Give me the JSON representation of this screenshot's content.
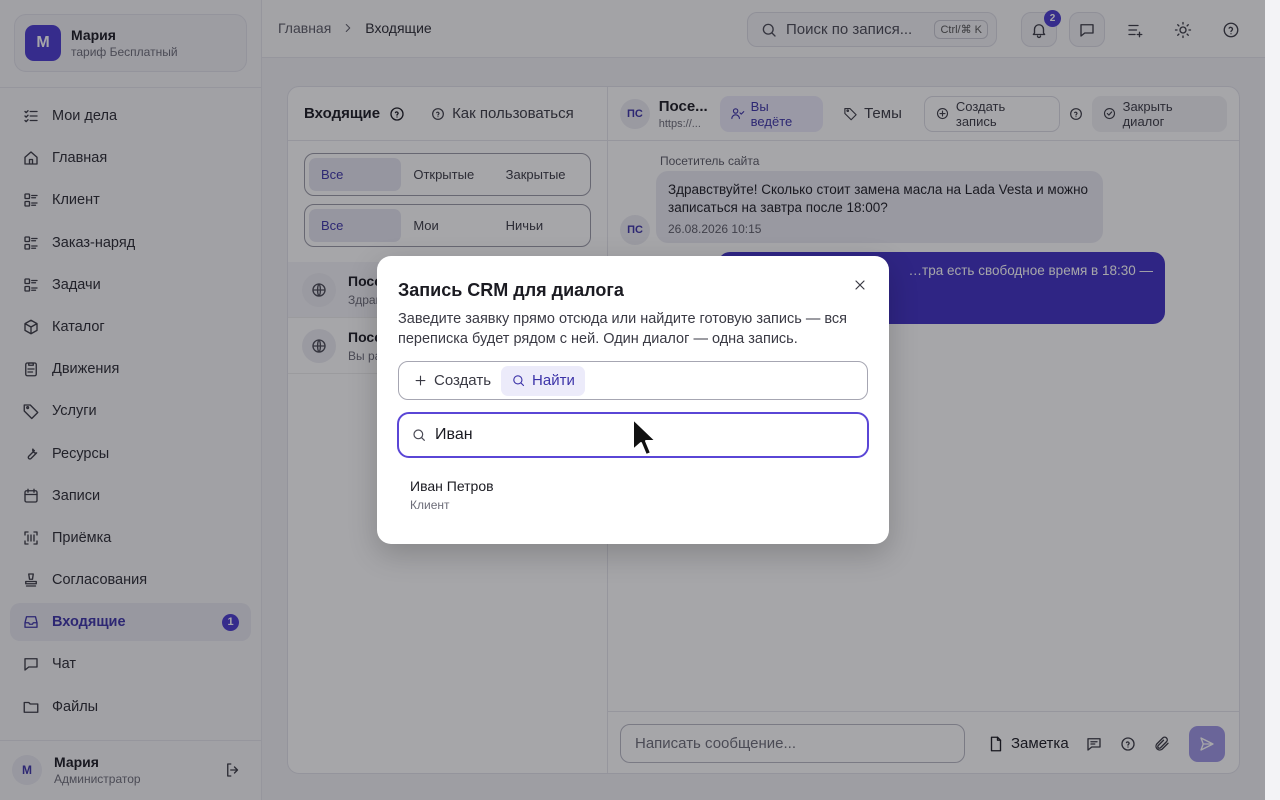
{
  "org": {
    "avatar": "М",
    "name": "Мария",
    "plan": "тариф Бесплатный"
  },
  "nav": [
    {
      "label": "Мои дела",
      "icon": "checklist-icon"
    },
    {
      "label": "Главная",
      "icon": "home-icon"
    },
    {
      "label": "Клиент",
      "icon": "list-icon"
    },
    {
      "label": "Заказ-наряд",
      "icon": "list-icon"
    },
    {
      "label": "Задачи",
      "icon": "list-icon"
    },
    {
      "label": "Каталог",
      "icon": "box-icon"
    },
    {
      "label": "Движения",
      "icon": "clipboard-icon"
    },
    {
      "label": "Услуги",
      "icon": "tag-icon"
    },
    {
      "label": "Ресурсы",
      "icon": "wrench-icon"
    },
    {
      "label": "Записи",
      "icon": "calendar-icon"
    },
    {
      "label": "Приёмка",
      "icon": "scan-icon"
    },
    {
      "label": "Согласования",
      "icon": "stamp-icon"
    },
    {
      "label": "Входящие",
      "icon": "inbox-icon",
      "active": true,
      "badge": "1"
    },
    {
      "label": "Чат",
      "icon": "chat-icon"
    },
    {
      "label": "Файлы",
      "icon": "folder-icon"
    }
  ],
  "user": {
    "avatar": "М",
    "name": "Мария",
    "role": "Администратор"
  },
  "topbar": {
    "crumb_home": "Главная",
    "crumb_current": "Входящие",
    "search_placeholder": "Поиск по запися...",
    "search_shortcut": "Ctrl/⌘ K",
    "notifications_count": "2"
  },
  "inbox": {
    "title": "Входящие",
    "how_to": "Как пользоваться",
    "filter_status": [
      "Все",
      "Открытые",
      "Закрытые"
    ],
    "filter_owner": [
      "Все",
      "Мои",
      "Ничьи"
    ],
    "conversations": [
      {
        "title": "Посе",
        "preview": "Здрав"
      },
      {
        "title": "Посе",
        "preview": "Вы ра"
      }
    ]
  },
  "dialog": {
    "avatar": "ПС",
    "visitor_name": "Посе...",
    "visitor_url": "https://...",
    "lead_label": "Вы ведёте",
    "topics_label": "Темы",
    "create_record_label": "Создать запись",
    "close_dialog_label": "Закрыть диалог",
    "sender": "Посетитель сайта",
    "incoming_text": "Здравствуйте! Сколько стоит замена масла на Lada Vesta и можно записаться на завтра после 18:00?",
    "incoming_time": "26.08.2026 10:15",
    "outgoing_text": "…тра есть свободное время в 18:30 —",
    "composer_placeholder": "Написать сообщение...",
    "note_label": "Заметка"
  },
  "modal": {
    "title": "Запись CRM для диалога",
    "description": "Заведите заявку прямо отсюда или найдите готовую запись — вся переписка будет рядом с ней. Один диалог — одна запись.",
    "tab_create": "Создать",
    "tab_find": "Найти",
    "search_value": "Иван",
    "results": [
      {
        "name": "Иван Петров",
        "type": "Клиент"
      }
    ]
  },
  "colors": {
    "accent": "#4b3bd0",
    "outgoing_bubble": "#3f30c4",
    "focus_ring": "#5a46d6"
  }
}
